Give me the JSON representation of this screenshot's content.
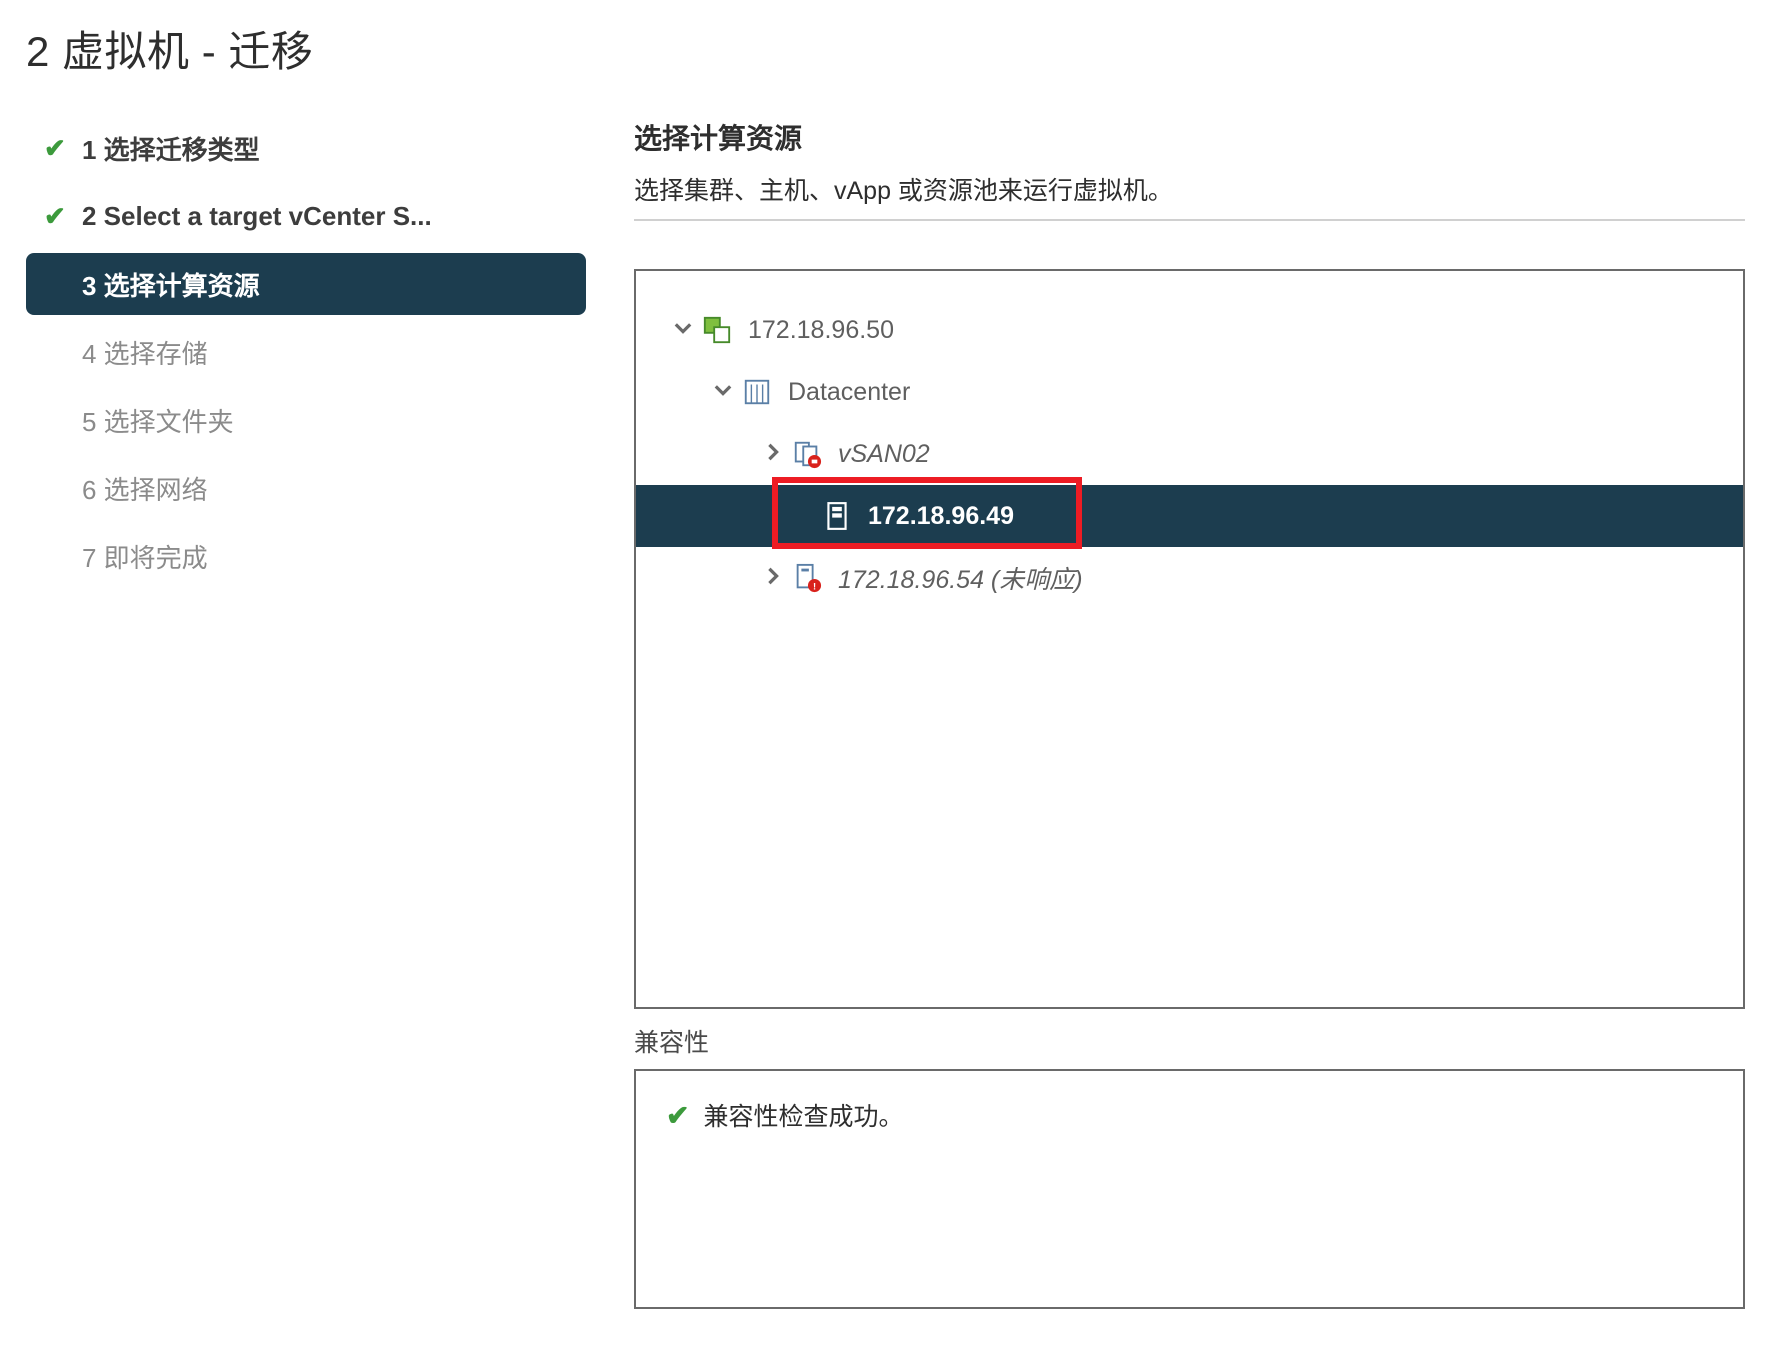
{
  "title": "2 虚拟机 - 迁移",
  "steps": [
    {
      "label": "1 选择迁移类型"
    },
    {
      "label": "2 Select a target vCenter S..."
    },
    {
      "label": "3 选择计算资源"
    },
    {
      "label": "4 选择存储"
    },
    {
      "label": "5 选择文件夹"
    },
    {
      "label": "6 选择网络"
    },
    {
      "label": "7 即将完成"
    }
  ],
  "heading": "选择计算资源",
  "subhead": "选择集群、主机、vApp 或资源池来运行虚拟机。",
  "tree": {
    "root": "172.18.96.50",
    "datacenter": "Datacenter",
    "cluster": "vSAN02",
    "host_selected": "172.18.96.49",
    "host_unresp": "172.18.96.54 (未响应)"
  },
  "compat_label": "兼容性",
  "compat_ok": "兼容性检查成功。"
}
